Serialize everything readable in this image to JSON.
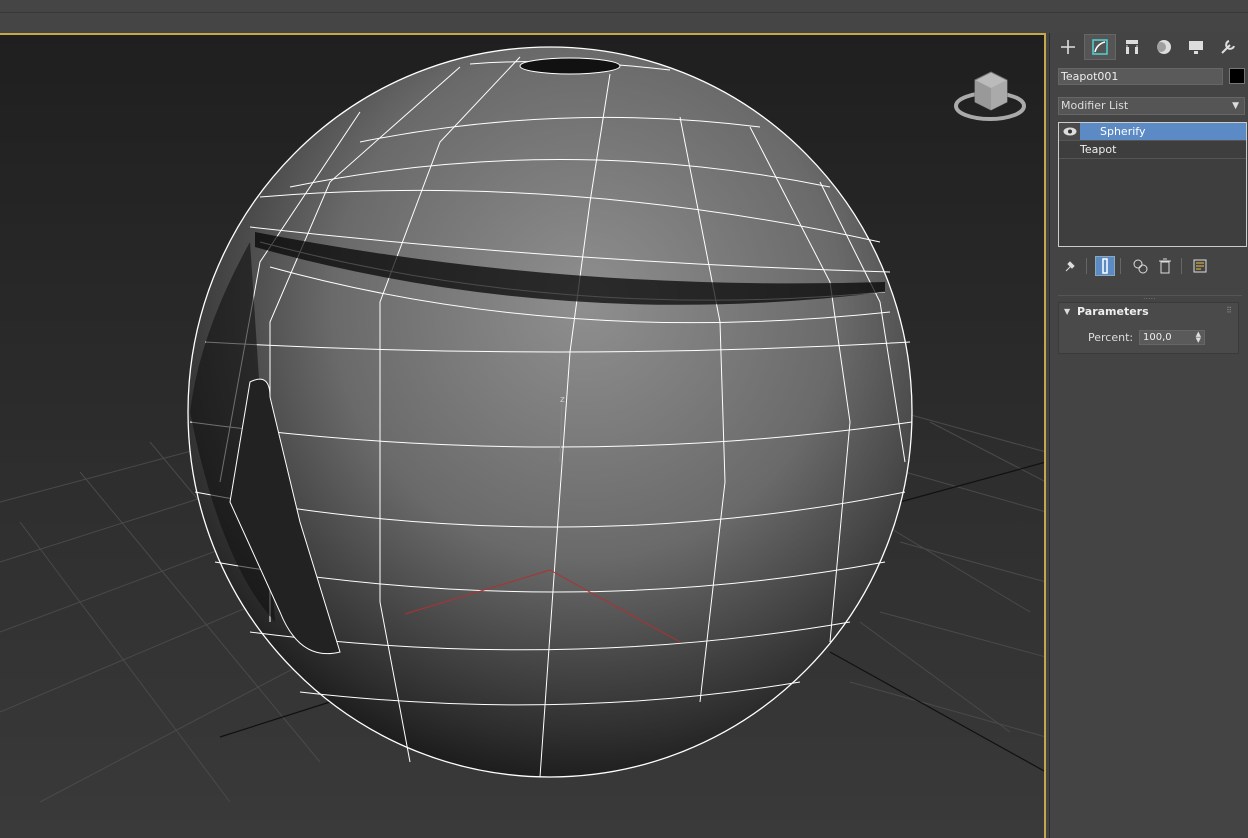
{
  "command_panel": {
    "tabs": [
      {
        "icon": "create-plus-icon",
        "active": false
      },
      {
        "icon": "modify-icon",
        "active": true
      },
      {
        "icon": "hierarchy-icon",
        "active": false
      },
      {
        "icon": "motion-icon",
        "active": false
      },
      {
        "icon": "display-icon",
        "active": false
      },
      {
        "icon": "utilities-wrench-icon",
        "active": false
      }
    ],
    "object_name": "Teapot001",
    "object_color": "#000000",
    "modifier_list_label": "Modifier List",
    "stack": [
      {
        "label": "Spherify",
        "selected": true,
        "visible_icon": "eye-icon"
      },
      {
        "label": "Teapot",
        "selected": false
      }
    ],
    "stack_tools": [
      "pin-stack-icon",
      "show-end-result-icon",
      "make-unique-icon",
      "remove-modifier-icon",
      "configure-sets-icon"
    ],
    "rollout": {
      "title": "Parameters",
      "percent_label": "Percent:",
      "percent_value": "100,0"
    }
  },
  "viewport": {
    "border_color": "#c4a84a",
    "background_top": "#1f1f1f",
    "background_bottom": "#3a3a3a",
    "axis_label_z": "z"
  }
}
